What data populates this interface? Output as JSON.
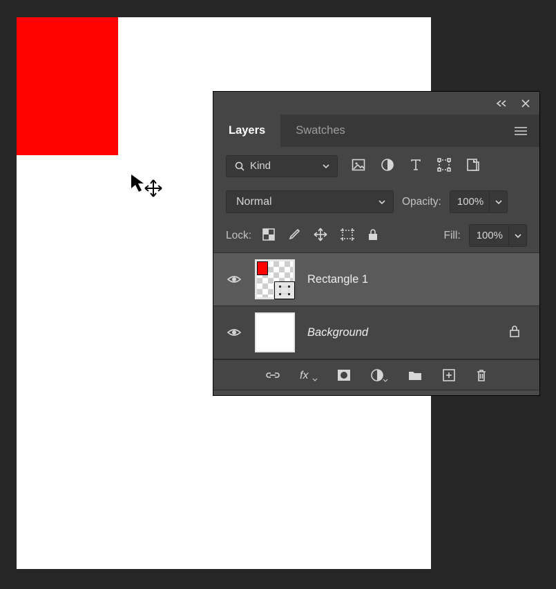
{
  "tabs": {
    "layers": "Layers",
    "swatches": "Swatches"
  },
  "filter": {
    "kind_label": "Kind"
  },
  "blend": {
    "mode": "Normal",
    "opacity_label": "Opacity:",
    "opacity_value": "100%"
  },
  "lock": {
    "label": "Lock:",
    "fill_label": "Fill:",
    "fill_value": "100%"
  },
  "layers": [
    {
      "name": "Rectangle 1",
      "selected": true,
      "italic": false,
      "locked": false,
      "type": "vector"
    },
    {
      "name": "Background",
      "selected": false,
      "italic": true,
      "locked": true,
      "type": "raster"
    }
  ]
}
